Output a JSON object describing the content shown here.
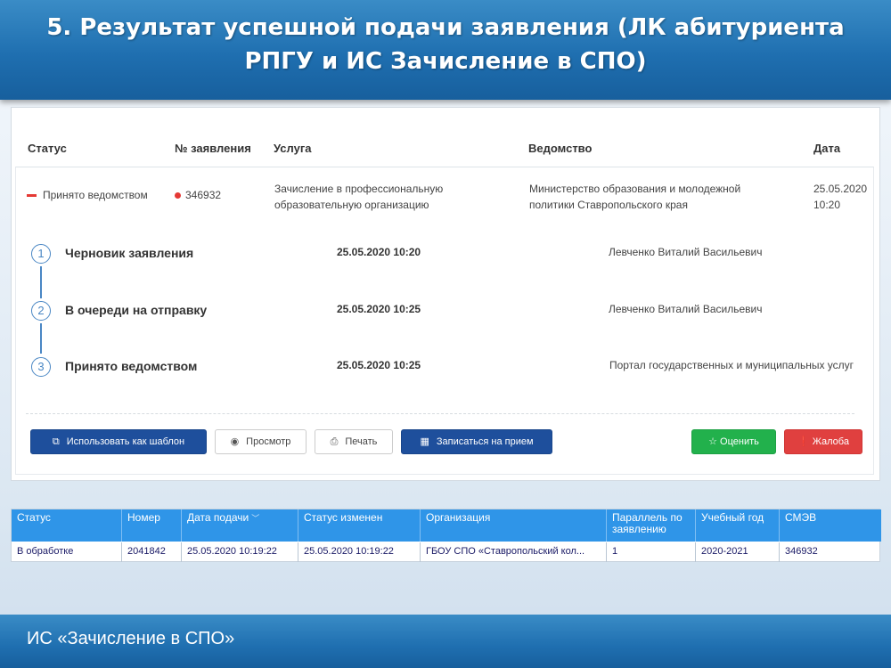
{
  "slide": {
    "title": "5. Результат успешной подачи заявления (ЛК абитуриента РПГУ и ИС Зачисление в СПО)",
    "footer": "ИС «Зачисление в СПО»"
  },
  "application_panel": {
    "headers": {
      "status": "Статус",
      "number": "№ заявления",
      "service": "Услуга",
      "department": "Ведомство",
      "date": "Дата"
    },
    "row": {
      "status": "Принято ведомством",
      "number": "346932",
      "service_line1": "Зачисление в профессиональную",
      "service_line2": "образовательную организацию",
      "department_line1": "Министерство образования и молодежной",
      "department_line2": "политики Ставропольского края",
      "date_line1": "25.05.2020",
      "date_line2": "10:20",
      "status_color": "#e53935"
    },
    "steps": [
      {
        "num": "1",
        "title": "Черновик заявления",
        "datetime": "25.05.2020 10:20",
        "who": "Левченко Виталий Васильевич"
      },
      {
        "num": "2",
        "title": "В очереди на отправку",
        "datetime": "25.05.2020 10:25",
        "who": "Левченко Виталий Васильевич"
      },
      {
        "num": "3",
        "title": "Принято ведомством",
        "datetime": "25.05.2020 10:25",
        "who": "Портал государственных и муниципальных услуг"
      }
    ],
    "buttons": {
      "template": "Использовать как шаблон",
      "preview": "Просмотр",
      "print": "Печать",
      "appointment": "Записаться на прием",
      "rate": "Оценить",
      "complaint": "Жалоба"
    },
    "icons": {
      "template": "copy-icon",
      "preview": "eye-icon",
      "print": "print-icon",
      "appointment": "calendar-icon",
      "rate": "star-icon",
      "complaint": "exclamation-circle-icon"
    },
    "colors": {
      "primary": "#1e4f9c",
      "success": "#22b14c",
      "danger": "#e0403f",
      "step": "#4a87c4"
    }
  },
  "grid": {
    "columns": [
      "Статус",
      "Номер",
      "Дата подачи",
      "Статус изменен",
      "Организация",
      "Параллель по заявлению",
      "Учебный год",
      "СМЭВ"
    ],
    "sorted_column_marker": "﹀",
    "rows": [
      [
        "В обработке",
        "2041842",
        "25.05.2020 10:19:22",
        "25.05.2020 10:19:22",
        "ГБОУ СПО «Ставропольский кол...",
        "1",
        "2020-2021",
        "346932"
      ]
    ],
    "header_color": "#2f95e8"
  }
}
